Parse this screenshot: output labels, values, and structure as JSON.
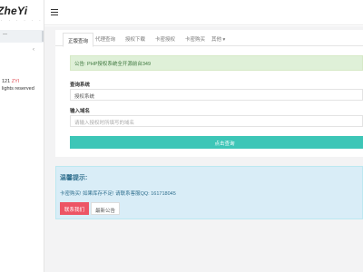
{
  "sidebar": {
    "logo": "ZheYi",
    "logo_sub": "· · · · · ·",
    "active_item": "—",
    "chevron": "‹",
    "copyright_prefix": "121",
    "copyright_version": "ZYI",
    "copyright_rights": "lights reserved"
  },
  "header": {
    "menu_icon": "hamburger-icon"
  },
  "tabs": [
    {
      "label": "正版查询",
      "active": true
    },
    {
      "label": "代理查询",
      "active": false
    },
    {
      "label": "授权下载",
      "active": false
    },
    {
      "label": "卡密授权",
      "active": false
    },
    {
      "label": "卡密购买",
      "active": false
    },
    {
      "label": "其他 ▾",
      "active": false
    }
  ],
  "notice": "公告: PHP授权系统全开源前台349",
  "form": {
    "system_label": "查询系统",
    "system_value": "授权系统",
    "domain_label": "输入域名",
    "domain_placeholder": "请输入授权时所填写的域名",
    "submit_label": "点击查询"
  },
  "tips": {
    "title": "温馨提示:",
    "text": "卡密购买! 如果库存不足! 请联系客服QQ: 161718045",
    "contact_button": "联系我们",
    "latest_notice_button": "最新公告"
  },
  "colors": {
    "accent_teal": "#3dc6b7",
    "danger": "#ed5565",
    "success_bg": "#dff0d8",
    "info_bg": "#d9edf7"
  }
}
